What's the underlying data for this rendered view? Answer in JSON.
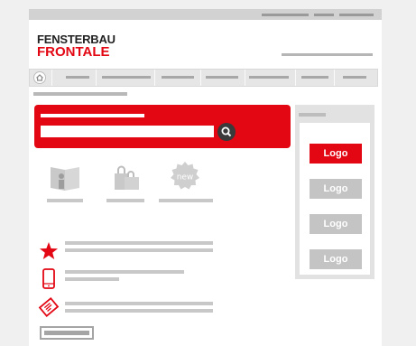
{
  "header": {
    "logo_line1": "FENSTERBAU",
    "logo_line2": "FRONTALE"
  },
  "sponsors": {
    "logos": [
      "Logo",
      "Logo",
      "Logo",
      "Logo"
    ],
    "active_color": "#e30613",
    "inactive_color": "#c4c4c4"
  },
  "search": {
    "placeholder": ""
  },
  "colors": {
    "brand_red": "#e30613",
    "placeholder_gray": "#c8c8c8"
  },
  "icons": {
    "home": "home-icon",
    "search": "magnifier-icon",
    "star": "star-icon",
    "mobile": "mobile-phone-icon",
    "ticket": "ticket-icon",
    "exhibitor": "exhibitor-stand-icon",
    "shopping": "shopping-bag-icon",
    "new": "new-badge-icon"
  }
}
